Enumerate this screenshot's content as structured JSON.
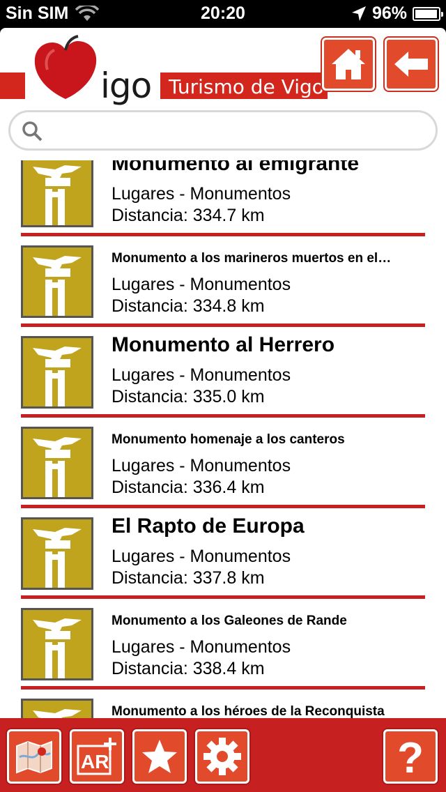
{
  "status": {
    "carrier": "Sin SIM",
    "time": "20:20",
    "battery": "96%",
    "battery_level": 0.96
  },
  "header": {
    "logo_text": "igo",
    "tagline": "Turismo de Vigo"
  },
  "search": {
    "placeholder": "",
    "value": ""
  },
  "items": [
    {
      "title": "Monumento al emigrante",
      "category": "Lugares - Monumentos",
      "distance": "Distancia: 334.7 km",
      "size": "big"
    },
    {
      "title": "Monumento a los marineros muertos en el…",
      "category": "Lugares - Monumentos",
      "distance": "Distancia: 334.8 km",
      "size": "small"
    },
    {
      "title": "Monumento al Herrero",
      "category": "Lugares - Monumentos",
      "distance": "Distancia: 335.0 km",
      "size": "big"
    },
    {
      "title": "Monumento homenaje a los canteros",
      "category": "Lugares - Monumentos",
      "distance": "Distancia: 336.4 km",
      "size": "small"
    },
    {
      "title": "El Rapto de Europa",
      "category": "Lugares - Monumentos",
      "distance": "Distancia: 337.8 km",
      "size": "big"
    },
    {
      "title": "Monumento a los Galeones de Rande",
      "category": "Lugares - Monumentos",
      "distance": "Distancia: 338.4 km",
      "size": "small"
    },
    {
      "title": "Monumento a los héroes de la Reconquista",
      "category": "",
      "distance": "",
      "size": "small"
    }
  ],
  "toolbar": {
    "ar_label": "AR",
    "help_label": "?"
  },
  "colors": {
    "brand_red": "#d3261c",
    "button_orange": "#e24a2c",
    "thumb_gold": "#c1a41e"
  },
  "icons": {
    "home": "home-icon",
    "back": "back-arrow-icon",
    "map": "map-icon",
    "ar": "ar-icon",
    "favorite": "star-icon",
    "settings": "gear-icon",
    "help": "question-icon",
    "search": "search-icon"
  }
}
